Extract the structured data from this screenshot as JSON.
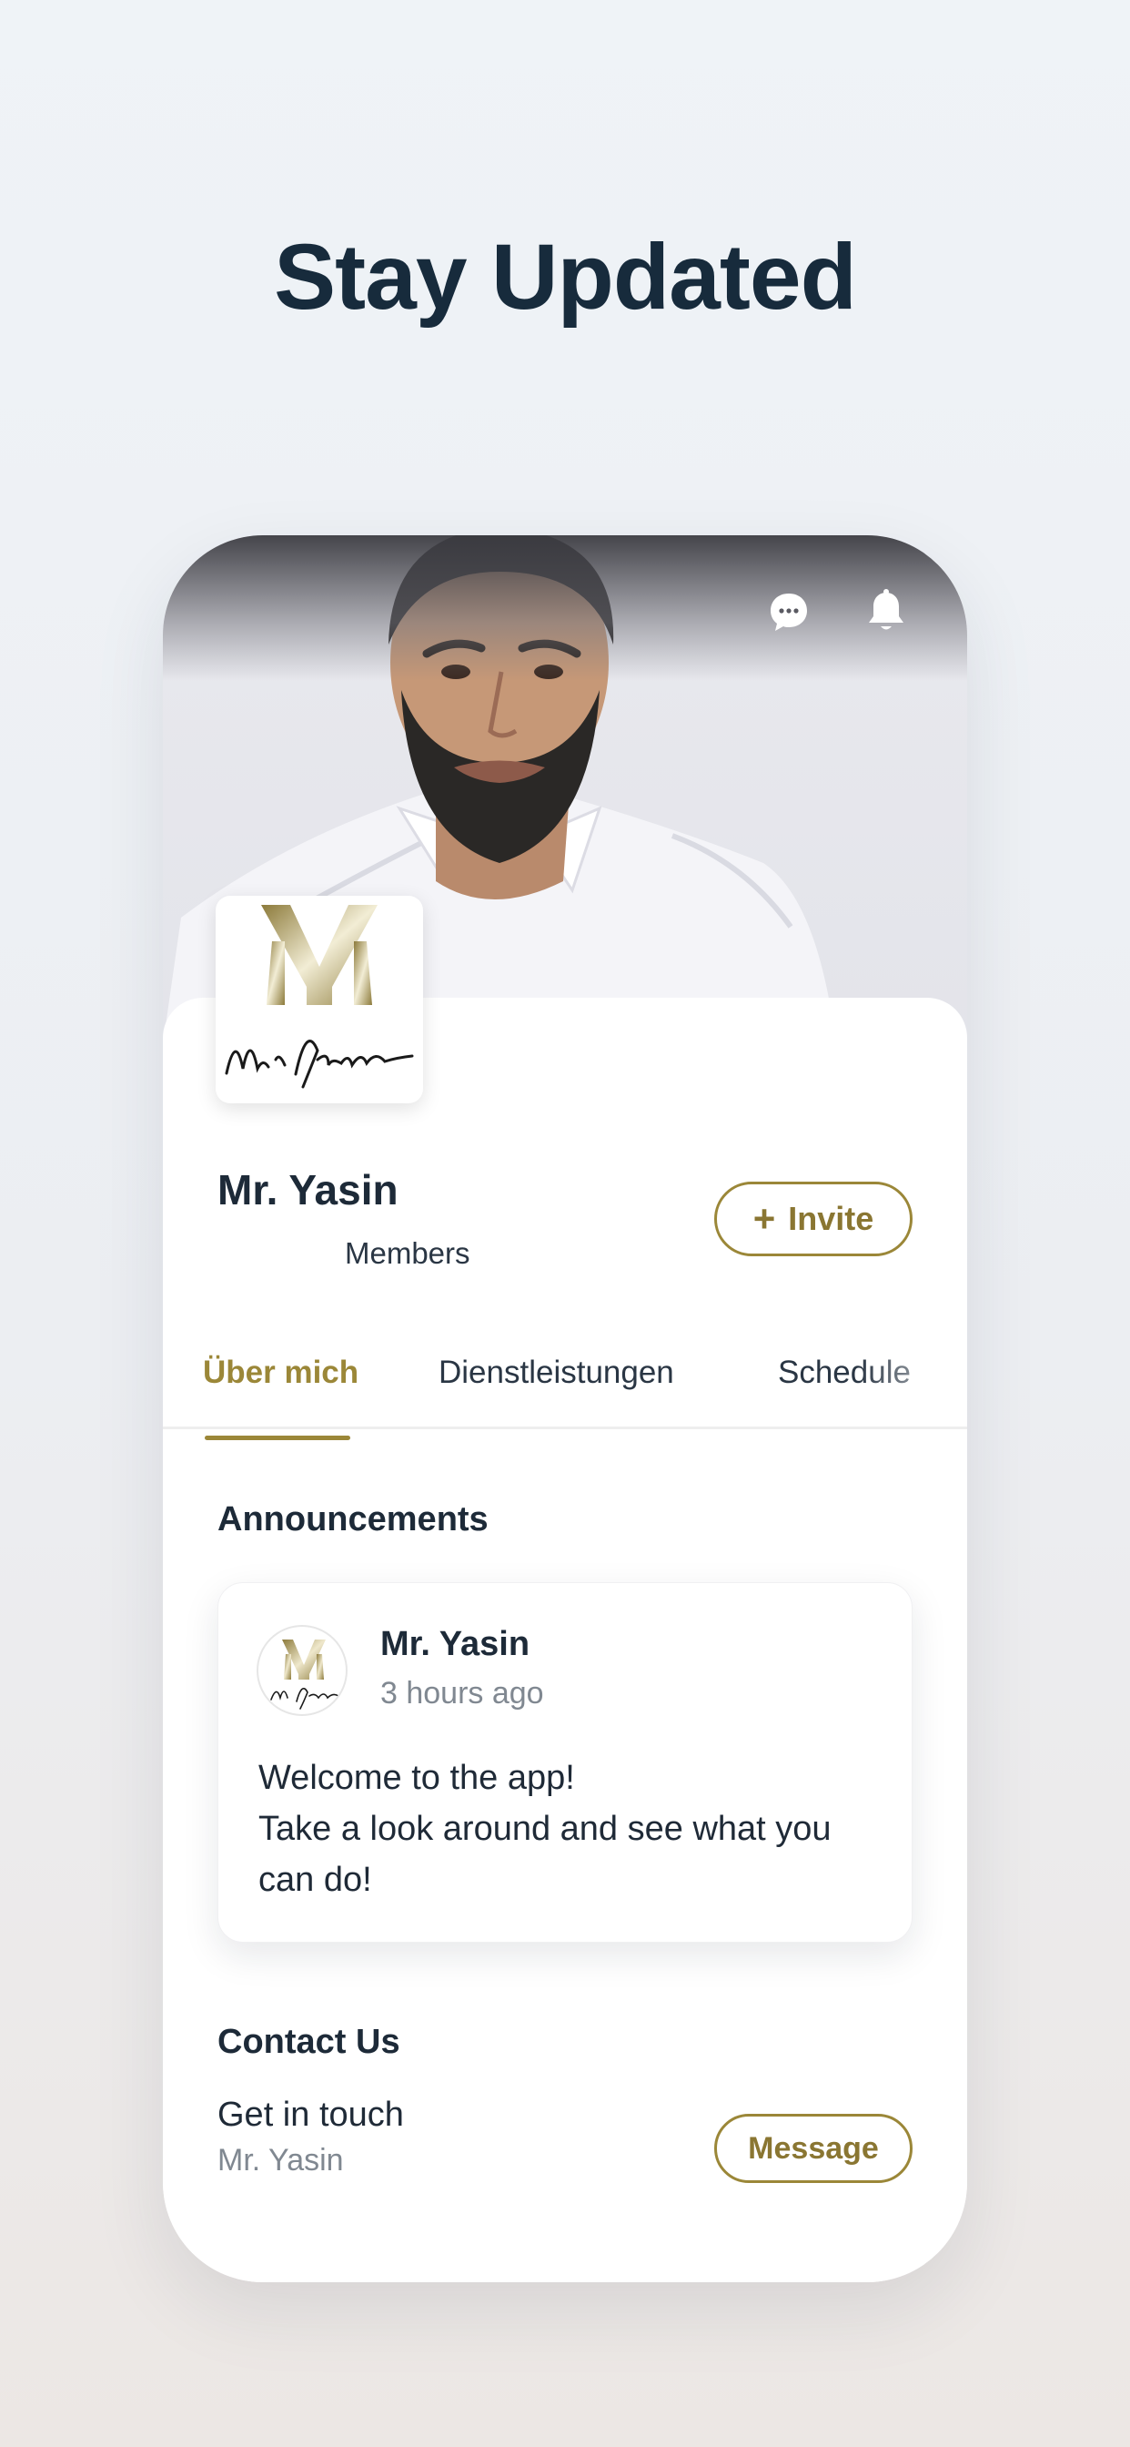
{
  "headline": "Stay Updated",
  "header_icons": [
    "chat-icon",
    "bell-icon"
  ],
  "profile": {
    "name": "Mr. Yasin",
    "members_label": "Members",
    "invite_label": "Invite",
    "logo_signature": "Mr. Yasin"
  },
  "tabs": [
    {
      "label": "Über mich",
      "active": true
    },
    {
      "label": "Dienstleistungen",
      "active": false
    },
    {
      "label": "Schedule",
      "active": false
    }
  ],
  "announcements": {
    "title": "Announcements",
    "posts": [
      {
        "author": "Mr. Yasin",
        "time": "3 hours ago",
        "body_line1": "Welcome to the app!",
        "body_line2": "Take a look around and see what you can do!"
      }
    ]
  },
  "contact": {
    "title": "Contact Us",
    "subtitle": "Get in touch",
    "name": "Mr. Yasin",
    "message_label": "Message"
  },
  "colors": {
    "accent_gold": "#9b8738",
    "headline": "#172b3c",
    "text": "#1d2a38",
    "muted": "#808891"
  }
}
